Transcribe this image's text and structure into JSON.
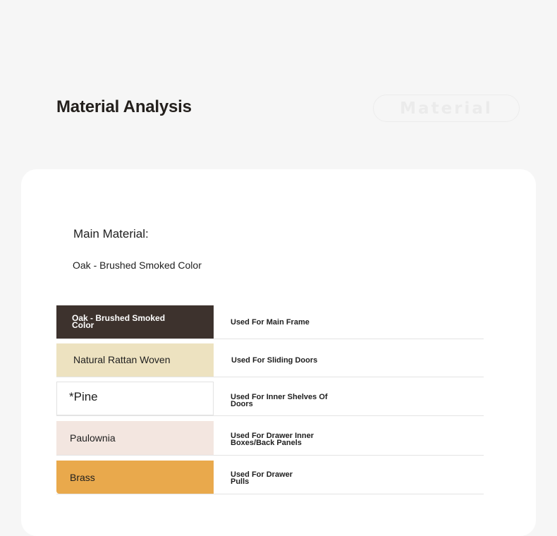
{
  "header": {
    "title": "Material Analysis",
    "watermark": "Material"
  },
  "main": {
    "label": "Main Material:",
    "value": "Oak - Brushed Smoked Color"
  },
  "materials": [
    {
      "name": "Oak - Brushed Smoked Color",
      "usage": "Used For Main Frame",
      "color": "#3d322d",
      "text_color": "#ffffff"
    },
    {
      "name": "Natural Rattan Woven",
      "usage": "Used For Sliding Doors",
      "color": "#ede2c0",
      "text_color": "#1e1e1e"
    },
    {
      "name": "*Pine",
      "usage": "Used For Inner Shelves Of Doors",
      "color": "#ffffff",
      "text_color": "#1e1e1e"
    },
    {
      "name": "Paulownia",
      "usage": "Used For Drawer Inner Boxes/Back Panels",
      "color": "#f3e6e0",
      "text_color": "#1e1e1e"
    },
    {
      "name": "Brass",
      "usage": "Used For Drawer Pulls",
      "color": "#e9a94c",
      "text_color": "#1e1e1e"
    }
  ]
}
